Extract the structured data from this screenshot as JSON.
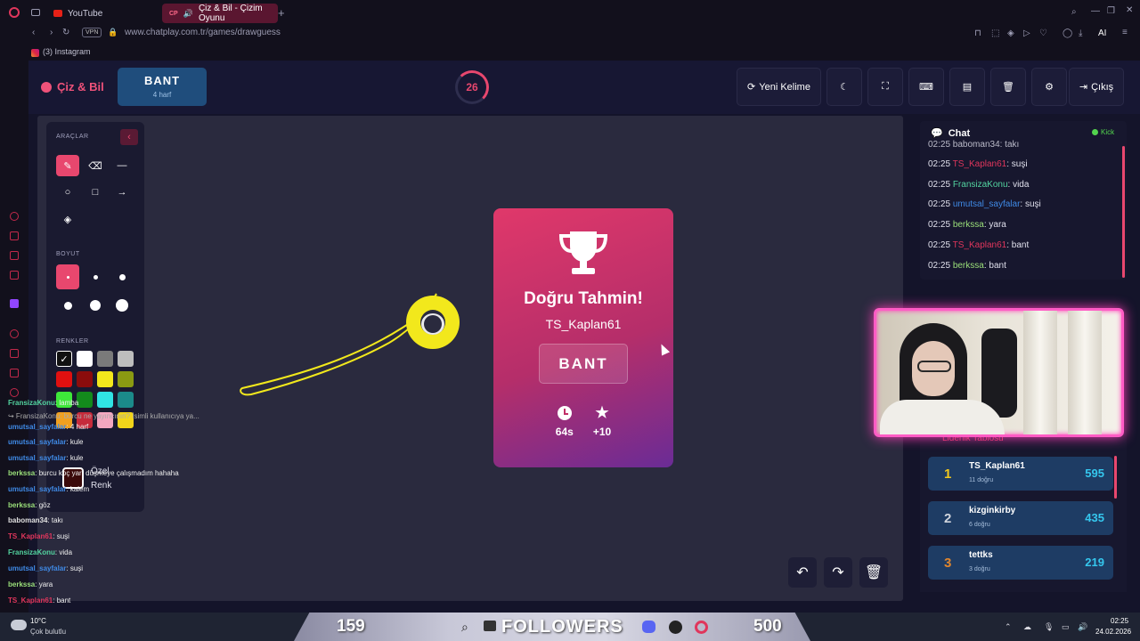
{
  "browser": {
    "tabs": [
      {
        "label": "YouTube"
      },
      {
        "label": "Çiz & Bil - Çizim Oyunu",
        "badge": "CP"
      }
    ],
    "url": "www.chatplay.com.tr/games/drawguess",
    "vpn_label": "VPN",
    "ai_label": "AI",
    "bookmark": "(3) Instagram"
  },
  "header": {
    "logo": "Çiz & Bil",
    "word": "BANT",
    "word_hint": "4 harf",
    "timer": "26",
    "timer_progress": 0.3,
    "new_word_label": "Yeni Kelime",
    "exit_label": "Çıkış"
  },
  "tools": {
    "tools_title": "ARAÇLAR",
    "size_title": "BOYUT",
    "colors_title": "RENKLER",
    "custom_color_line1": "Özel",
    "custom_color_line2": "Renk",
    "colors": [
      "#111111",
      "#ffffff",
      "#7a7a7a",
      "#bdbdbd",
      "#e01010",
      "#8b0c0c",
      "#f2e81c",
      "#8a9a12",
      "#3ee83a",
      "#138a1c",
      "#30e4e4",
      "#1b8a8a",
      "#f0a020",
      "#c62b3b",
      "#f4a7c0",
      "#f2d41a"
    ]
  },
  "popup": {
    "title": "Doğru Tahmin!",
    "player": "TS_Kaplan61",
    "word": "BANT",
    "time": "64s",
    "points": "+10"
  },
  "chat": {
    "title": "Chat",
    "kick_label": "Kick",
    "partial": "02:25 baboman34: takı",
    "messages": [
      {
        "time": "02:25",
        "user": "TS_Kaplan61",
        "text": ": suşi",
        "color": "#e0365c"
      },
      {
        "time": "02:25",
        "user": "FransizaKonu",
        "text": ": vida",
        "color": "#53d4a0"
      },
      {
        "time": "02:25",
        "user": "umutsal_sayfalar",
        "text": ": suşi",
        "color": "#3f8ae6"
      },
      {
        "time": "02:25",
        "user": "berkssa",
        "text": ": yara",
        "color": "#9be07a"
      },
      {
        "time": "02:25",
        "user": "TS_Kaplan61",
        "text": ": bant",
        "color": "#e0365c"
      },
      {
        "time": "02:25",
        "user": "berkssa",
        "text": ": bant",
        "color": "#9be07a"
      }
    ]
  },
  "leaderboard": {
    "title": "Liderlik Tablosu",
    "rows": [
      {
        "rank": "1",
        "name": "TS_Kaplan61",
        "detail": "11 doğru",
        "score": "595",
        "color": "#f2c81c"
      },
      {
        "rank": "2",
        "name": "kizginkirby",
        "detail": "6 doğru",
        "score": "435",
        "color": "#d0d4dc"
      },
      {
        "rank": "3",
        "name": "tettks",
        "detail": "3 doğru",
        "score": "219",
        "color": "#e0862e"
      }
    ]
  },
  "overlay_chat": [
    {
      "user": "FransizaKonu",
      "text": ": lamba",
      "color": "#53d4a0"
    },
    {
      "user": "",
      "text": "↪ FransizaKonu: burcu ne yayıncının? İsimli kullanıcıya ya...",
      "color": "#aaaaaa"
    },
    {
      "user": "umutsal_sayfalar",
      "text": ": 4 harf",
      "color": "#3f8ae6"
    },
    {
      "user": "umutsal_sayfalar",
      "text": ": kule",
      "color": "#3f8ae6"
    },
    {
      "user": "umutsal_sayfalar",
      "text": ": kule",
      "color": "#3f8ae6"
    },
    {
      "user": "berkssa",
      "text": ": burcu koç yarı düşmeye çalışmadım hahaha",
      "color": "#9be07a"
    },
    {
      "user": "umutsal_sayfalar",
      "text": ": kalem",
      "color": "#3f8ae6"
    },
    {
      "user": "berkssa",
      "text": ": göz",
      "color": "#9be07a"
    },
    {
      "user": "baboman34",
      "text": ": takı",
      "color": "#e0e0e0"
    },
    {
      "user": "TS_Kaplan61",
      "text": ": suşi",
      "color": "#e0365c"
    },
    {
      "user": "FransizaKonu",
      "text": ": vida",
      "color": "#53d4a0"
    },
    {
      "user": "umutsal_sayfalar",
      "text": ": suşi",
      "color": "#3f8ae6"
    },
    {
      "user": "berkssa",
      "text": ": yara",
      "color": "#9be07a"
    },
    {
      "user": "TS_Kaplan61",
      "text": ": bant",
      "color": "#e0365c"
    },
    {
      "user": "berkssa",
      "text": ": bant",
      "color": "#9be07a"
    }
  ],
  "taskbar": {
    "weather_temp": "10°C",
    "weather_desc": "Çok bulutlu",
    "followers_current": "159",
    "followers_label": "FOLLOWERS",
    "followers_goal": "500",
    "followers_progress": 0.318,
    "time": "02:25",
    "date": "24.02.2026"
  }
}
